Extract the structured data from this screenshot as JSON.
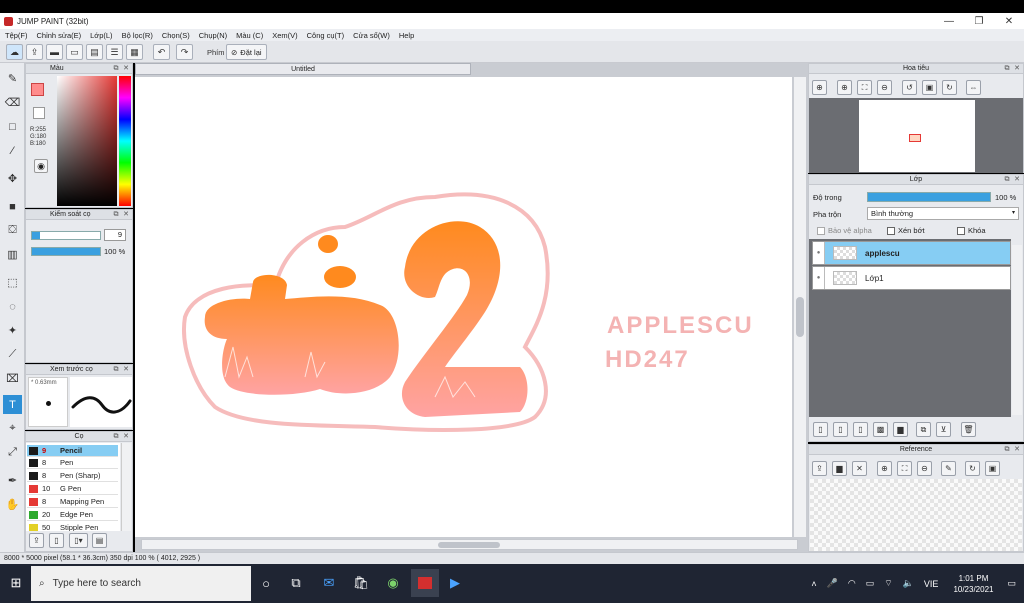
{
  "window": {
    "title": "JUMP PAINT (32bit)",
    "minimize": "—",
    "restore": "❐",
    "close": "✕"
  },
  "menu": [
    "Tệp(F)",
    "Chỉnh sửa(E)",
    "Lớp(L)",
    "Bộ lọc(R)",
    "Chọn(S)",
    "Chụp(N)",
    "Màu (C)",
    "Xem(V)",
    "Công cụ(T)",
    "Cửa sổ(W)",
    "Help"
  ],
  "toolbar": {
    "key_label": "Phím",
    "reset_label": "Đặt lại"
  },
  "color_panel": {
    "title": "Màu",
    "rgb": [
      "R:255",
      "G:180",
      "B:180"
    ],
    "fg_color": "#ff8c8c",
    "bg_color": "#ff9a00"
  },
  "brush_control": {
    "title": "Kiểm soát cọ",
    "size": "9",
    "opacity": "100 %"
  },
  "brush_preview": {
    "title": "Xem trước cọ",
    "size_label": "* 0.63mm"
  },
  "brush_list": {
    "title": "Cọ",
    "items": [
      {
        "size": "9",
        "name": "Pencil",
        "color": "#1a1a1a",
        "selected": true
      },
      {
        "size": "8",
        "name": "Pen",
        "color": "#1a1a1a"
      },
      {
        "size": "8",
        "name": "Pen (Sharp)",
        "color": "#1a1a1a"
      },
      {
        "size": "10",
        "name": "G Pen",
        "color": "#e53935"
      },
      {
        "size": "8",
        "name": "Mapping Pen",
        "color": "#e53935"
      },
      {
        "size": "20",
        "name": "Edge Pen",
        "color": "#2eaa2e"
      },
      {
        "size": "50",
        "name": "Stipple Pen",
        "color": "#e3d126"
      }
    ]
  },
  "document": {
    "tab_title": "Untitled"
  },
  "artwork": {
    "main_text": "tô2",
    "side_line1": "APPLESCU",
    "side_line2": "HD247",
    "side_color": "#f4b3b3",
    "orange": "#ff8a1e",
    "pink": "#ffa3a3"
  },
  "navigator": {
    "title": "Hoa tiêu"
  },
  "layers": {
    "title": "Lớp",
    "opacity_label": "Độ trong",
    "opacity_value": "100 %",
    "opacity_fraction": 1.0,
    "blend_label": "Pha trộn",
    "blend_value": "Bình thường",
    "protect_alpha": "Bảo vệ alpha",
    "clipping": "Xén bớt",
    "lock": "Khóa",
    "items": [
      {
        "name": "applescu",
        "selected": true
      },
      {
        "name": "Lớp1",
        "selected": false
      }
    ]
  },
  "reference": {
    "title": "Reference"
  },
  "status": {
    "text": "8000 * 5000 pixel  (58.1 * 36.3cm)  350 dpi  100 %  ( 4012, 2925 )"
  },
  "taskbar": {
    "search_placeholder": "Type here to search",
    "time": "1:01 PM",
    "date": "10/23/2021",
    "lang": "VIE"
  }
}
